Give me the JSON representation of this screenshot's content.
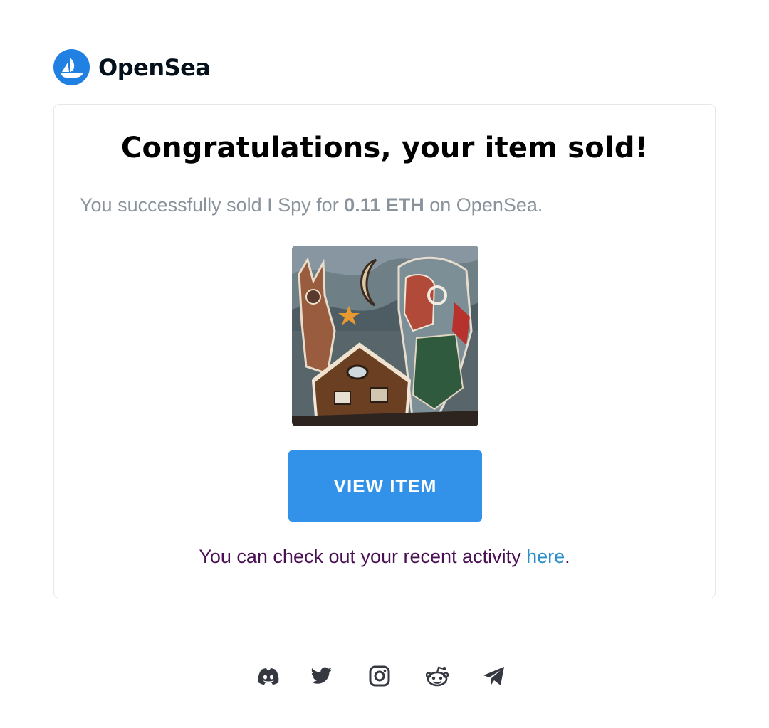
{
  "brand": {
    "name": "OpenSea",
    "accent_color": "#2081e2"
  },
  "card": {
    "title": "Congratulations, your item sold!",
    "message": {
      "prefix": "You successfully sold I Spy for ",
      "price": "0.11 ETH",
      "suffix": " on OpenSea."
    },
    "artwork": {
      "item_name": "I Spy"
    },
    "view_button_label": "VIEW ITEM",
    "button_color": "#3291e9",
    "activity": {
      "prefix": "You can check out your recent activity ",
      "link_label": "here",
      "suffix": "."
    }
  },
  "social": {
    "icons": [
      "discord-icon",
      "twitter-icon",
      "instagram-icon",
      "reddit-icon",
      "telegram-icon"
    ]
  }
}
